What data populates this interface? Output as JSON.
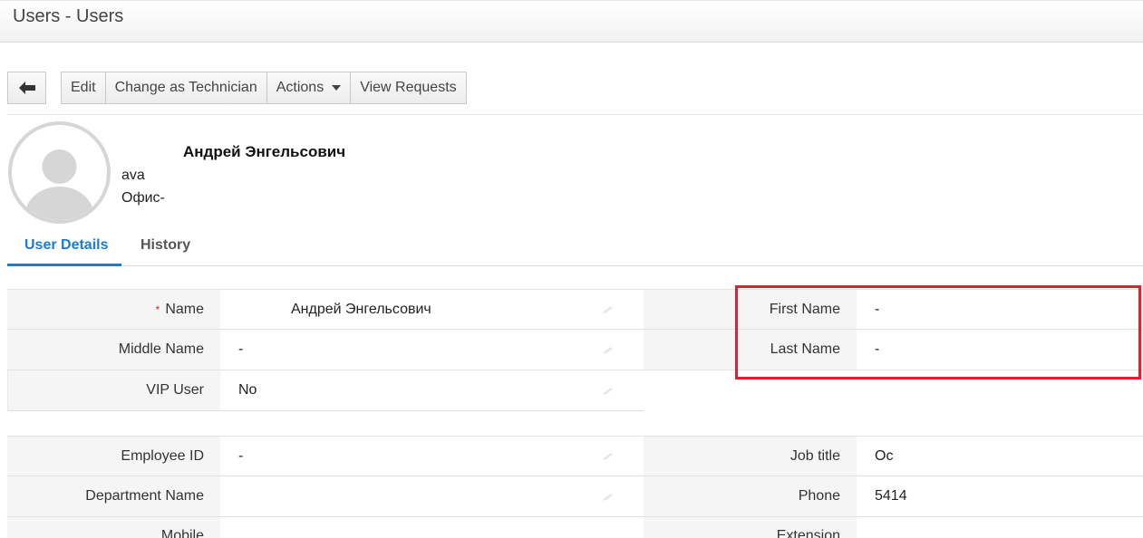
{
  "header": {
    "title": "Users - Users"
  },
  "toolbar": {
    "back_icon": "arrow-left-icon",
    "edit": "Edit",
    "change_technician": "Change as Technician",
    "actions": "Actions",
    "view_requests": "View Requests"
  },
  "profile": {
    "name": "Андрей Энгельсович",
    "line1": "ava",
    "line2": "Офис-",
    "avatar_icon": "user-silhouette-icon"
  },
  "tabs": [
    {
      "label": "User Details",
      "active": true
    },
    {
      "label": "History",
      "active": false
    }
  ],
  "details1": [
    {
      "label": "Name",
      "required": "*",
      "value": "Андрей Энгельсович"
    },
    {
      "label": "Middle Name",
      "value": "-"
    },
    {
      "label": "VIP User",
      "value": "No"
    }
  ],
  "details1_right": [
    {
      "label": "First Name",
      "value": "-"
    },
    {
      "label": "Last Name",
      "value": "-"
    }
  ],
  "details2": [
    {
      "label": "Employee ID",
      "value": "-"
    },
    {
      "label": "Department Name",
      "value": ""
    },
    {
      "label": "Mobile",
      "value": ""
    }
  ],
  "details2_right": [
    {
      "label": "Job title",
      "value": "Oc"
    },
    {
      "label": "Phone",
      "value": "5414"
    },
    {
      "label": "Extension",
      "value": ""
    }
  ],
  "colors": {
    "accent": "#1a7bd2",
    "highlight": "#e0202e",
    "required": "#e02020"
  }
}
